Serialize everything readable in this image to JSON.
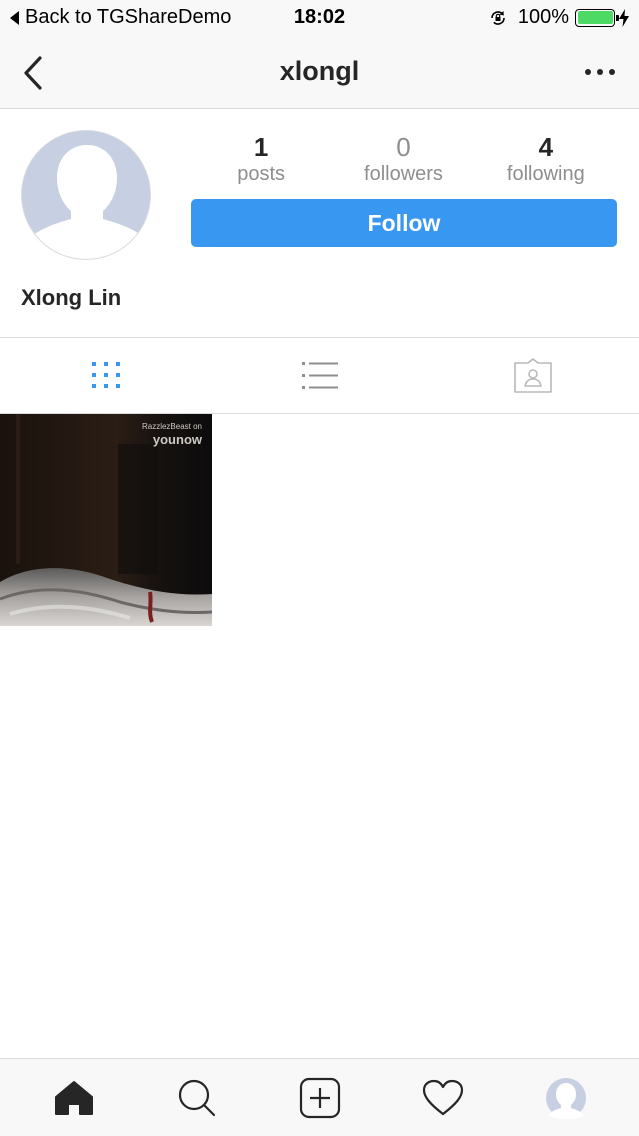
{
  "status_bar": {
    "back_label": "Back to TGShareDemo",
    "time": "18:02",
    "battery_percent": "100%",
    "battery_level": 1.0,
    "battery_color": "#4cd964"
  },
  "nav": {
    "title": "xlongl",
    "back_icon": "chevron-left-icon",
    "more_icon": "more-dots-icon"
  },
  "profile": {
    "full_name": "Xlong Lin",
    "stats": [
      {
        "value": "1",
        "label": "posts"
      },
      {
        "value": "0",
        "label": "followers"
      },
      {
        "value": "4",
        "label": "following"
      }
    ],
    "follow_label": "Follow",
    "follow_color": "#3897f0"
  },
  "view_tabs": [
    {
      "icon": "grid-view-icon",
      "active": true
    },
    {
      "icon": "list-view-icon",
      "active": false
    },
    {
      "icon": "tagged-photos-icon",
      "active": false
    }
  ],
  "posts": [
    {
      "caption_small": "RazzlezBeast on",
      "caption_brand": "younow"
    }
  ],
  "tab_bar": {
    "icons": [
      "home-icon",
      "search-icon",
      "add-post-icon",
      "activity-heart-icon",
      "profile-avatar-icon"
    ]
  },
  "colors": {
    "accent": "#3897f0",
    "text": "#262626",
    "muted": "#8e8e8e",
    "border": "#dbdbdb"
  }
}
